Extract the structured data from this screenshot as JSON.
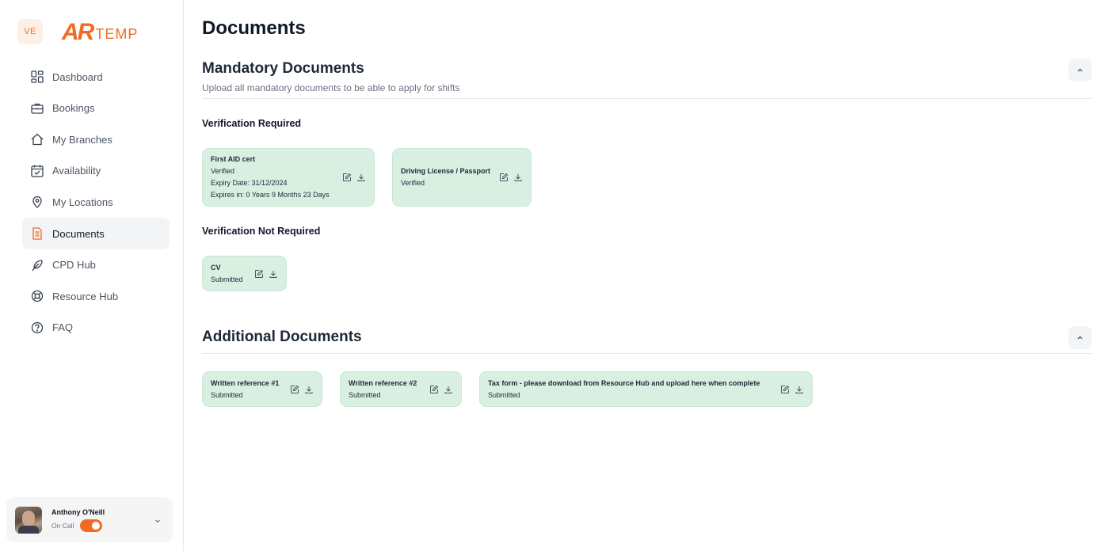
{
  "brand": {
    "badge": "VE",
    "logo_mark": "AR",
    "logo_text": "TEMP",
    "accent": "#f26b22"
  },
  "sidebar": {
    "items": [
      {
        "label": "Dashboard",
        "icon": "dashboard-icon",
        "active": false
      },
      {
        "label": "Bookings",
        "icon": "briefcase-icon",
        "active": false
      },
      {
        "label": "My Branches",
        "icon": "home-icon",
        "active": false
      },
      {
        "label": "Availability",
        "icon": "calendar-check-icon",
        "active": false
      },
      {
        "label": "My Locations",
        "icon": "location-pin-icon",
        "active": false
      },
      {
        "label": "Documents",
        "icon": "document-icon",
        "active": true
      },
      {
        "label": "CPD Hub",
        "icon": "feather-icon",
        "active": false
      },
      {
        "label": "Resource Hub",
        "icon": "lifebuoy-icon",
        "active": false
      },
      {
        "label": "FAQ",
        "icon": "help-circle-icon",
        "active": false
      }
    ]
  },
  "user": {
    "name": "Anthony O'Neill",
    "status": "On Call",
    "on_call": true
  },
  "page": {
    "title": "Documents"
  },
  "mandatory": {
    "title": "Mandatory Documents",
    "subtitle": "Upload all mandatory documents to be able to apply for shifts",
    "verification_required": {
      "title": "Verification Required",
      "cards": [
        {
          "title": "First AID cert",
          "status": "Verified",
          "expiry": "Expiry Date: 31/12/2024",
          "expires_in": "Expires in: 0 Years 9 Months 23 Days"
        },
        {
          "title": "Driving License / Passport",
          "status": "Verified"
        }
      ]
    },
    "verification_not_required": {
      "title": "Verification Not Required",
      "cards": [
        {
          "title": "CV",
          "status": "Submitted"
        }
      ]
    }
  },
  "additional": {
    "title": "Additional Documents",
    "cards": [
      {
        "title": "Written reference #1",
        "status": "Submitted"
      },
      {
        "title": "Written reference #2",
        "status": "Submitted"
      },
      {
        "title": "Tax form - please download from Resource Hub and upload here when complete",
        "status": "Submitted"
      }
    ]
  },
  "colors": {
    "card_bg": "#d8efe2",
    "active_nav_bg": "#f3f4f6",
    "muted_text": "#6b7280"
  }
}
